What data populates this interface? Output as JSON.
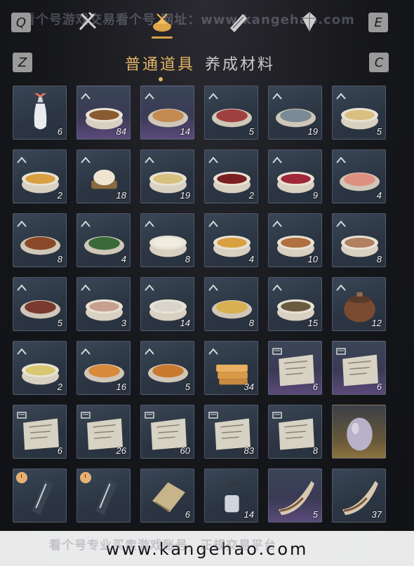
{
  "watermark_text": "看个号游戏交易看个号 网址：www.kangehao.com",
  "keys": {
    "q": "Q",
    "e": "E",
    "z": "Z",
    "c": "C"
  },
  "category_icons": [
    "weapon-icon",
    "food-icon",
    "scroll-icon",
    "gem-icon"
  ],
  "subtabs": {
    "active": "普通道具",
    "inactive": "养成材料"
  },
  "banner": {
    "text": "www.kangehao.com",
    "overlay": "看个号专业买卖游戏账号，正规交易平台"
  },
  "items": [
    {
      "icon": "vase-icon",
      "count": "6",
      "bg": "plain",
      "badge": ""
    },
    {
      "icon": "stew-pot-icon",
      "count": "84",
      "bg": "purple",
      "badge": "rank"
    },
    {
      "icon": "buns-plate-icon",
      "count": "14",
      "bg": "purple",
      "badge": "rank"
    },
    {
      "icon": "meat-plate-icon",
      "count": "5",
      "bg": "plain",
      "badge": "rank"
    },
    {
      "icon": "fish-plate-icon",
      "count": "19",
      "bg": "plain",
      "badge": "rank"
    },
    {
      "icon": "noodle-bowl-icon",
      "count": "5",
      "bg": "plain",
      "badge": "rank"
    },
    {
      "icon": "soup-bowl-icon",
      "count": "2",
      "bg": "plain",
      "badge": "rank"
    },
    {
      "icon": "steamed-bun-icon",
      "count": "18",
      "bg": "plain",
      "badge": "rank"
    },
    {
      "icon": "noodle-bowl-icon",
      "count": "19",
      "bg": "plain",
      "badge": "rank"
    },
    {
      "icon": "red-soup-icon",
      "count": "2",
      "bg": "plain",
      "badge": "rank"
    },
    {
      "icon": "berry-dish-icon",
      "count": "9",
      "bg": "plain",
      "badge": "rank"
    },
    {
      "icon": "sashimi-plate-icon",
      "count": "4",
      "bg": "plain",
      "badge": "rank"
    },
    {
      "icon": "braised-meat-icon",
      "count": "8",
      "bg": "plain",
      "badge": "rank"
    },
    {
      "icon": "greens-plate-icon",
      "count": "4",
      "bg": "plain",
      "badge": "rank"
    },
    {
      "icon": "dumplings-icon",
      "count": "8",
      "bg": "plain",
      "badge": "rank"
    },
    {
      "icon": "soup-bowl-icon",
      "count": "4",
      "bg": "plain",
      "badge": "rank"
    },
    {
      "icon": "stew-bowl-icon",
      "count": "10",
      "bg": "plain",
      "badge": "rank"
    },
    {
      "icon": "meat-bowl-icon",
      "count": "8",
      "bg": "plain",
      "badge": "rank"
    },
    {
      "icon": "fried-dish-icon",
      "count": "5",
      "bg": "plain",
      "badge": "rank"
    },
    {
      "icon": "porridge-icon",
      "count": "3",
      "bg": "plain",
      "badge": "rank"
    },
    {
      "icon": "rice-bowl-icon",
      "count": "14",
      "bg": "plain",
      "badge": "rank"
    },
    {
      "icon": "noodle-plate-icon",
      "count": "8",
      "bg": "plain",
      "badge": "rank"
    },
    {
      "icon": "fish-bowl-icon",
      "count": "15",
      "bg": "plain",
      "badge": "rank"
    },
    {
      "icon": "clay-pot-icon",
      "count": "12",
      "bg": "plain",
      "badge": "rank"
    },
    {
      "icon": "tofu-bowl-icon",
      "count": "2",
      "bg": "plain",
      "badge": "rank"
    },
    {
      "icon": "fried-balls-icon",
      "count": "16",
      "bg": "plain",
      "badge": "rank"
    },
    {
      "icon": "fried-cubes-icon",
      "count": "5",
      "bg": "plain",
      "badge": "rank"
    },
    {
      "icon": "pastry-stack-icon",
      "count": "34",
      "bg": "plain",
      "badge": "rank"
    },
    {
      "icon": "recipe-paper-icon",
      "count": "6",
      "bg": "purple",
      "badge": "scroll"
    },
    {
      "icon": "recipe-paper-icon",
      "count": "6",
      "bg": "purple",
      "badge": "scroll"
    },
    {
      "icon": "recipe-paper-icon",
      "count": "6",
      "bg": "plain",
      "badge": "scroll"
    },
    {
      "icon": "recipe-paper-icon",
      "count": "26",
      "bg": "plain",
      "badge": "scroll"
    },
    {
      "icon": "recipe-paper-icon",
      "count": "60",
      "bg": "plain",
      "badge": "scroll"
    },
    {
      "icon": "recipe-paper-icon",
      "count": "83",
      "bg": "plain",
      "badge": "scroll"
    },
    {
      "icon": "recipe-paper-icon",
      "count": "8",
      "bg": "plain",
      "badge": "scroll"
    },
    {
      "icon": "egg-icon",
      "count": "",
      "bg": "gold",
      "badge": ""
    },
    {
      "icon": "talisman-icon",
      "count": "",
      "bg": "plain",
      "badge": "clock"
    },
    {
      "icon": "talisman-icon",
      "count": "",
      "bg": "plain",
      "badge": "clock"
    },
    {
      "icon": "cloth-icon",
      "count": "6",
      "bg": "plain",
      "badge": ""
    },
    {
      "icon": "incense-jar-icon",
      "count": "14",
      "bg": "plain",
      "badge": ""
    },
    {
      "icon": "horn-icon",
      "count": "5",
      "bg": "purple",
      "badge": ""
    },
    {
      "icon": "horn-icon",
      "count": "37",
      "bg": "plain",
      "badge": ""
    }
  ]
}
